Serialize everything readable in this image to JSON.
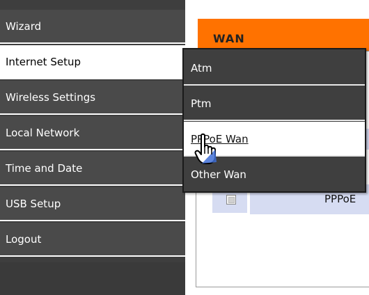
{
  "sidebar": {
    "items": [
      {
        "label": "Wizard"
      },
      {
        "label": "Internet Setup"
      },
      {
        "label": "Wireless Settings"
      },
      {
        "label": "Local Network"
      },
      {
        "label": "Time and Date"
      },
      {
        "label": "USB Setup"
      },
      {
        "label": "Logout"
      }
    ],
    "active_index": 1
  },
  "main": {
    "section_title": "WAN",
    "table_row": {
      "name": "PPPoE"
    }
  },
  "submenu": {
    "items": [
      {
        "label": "Atm"
      },
      {
        "label": "Ptm"
      },
      {
        "label": "PPPoE Wan"
      },
      {
        "label": "Other Wan"
      }
    ],
    "hovered_index": 2
  },
  "colors": {
    "sidebar_bg": "#4a4a4a",
    "accent_header": "#ff7200",
    "row_bg": "#d6dcf2",
    "menu_bg": "#3f3f3f"
  },
  "icons": {
    "cursor": "hand-pointer-icon",
    "checkbox": "checkbox-icon"
  }
}
